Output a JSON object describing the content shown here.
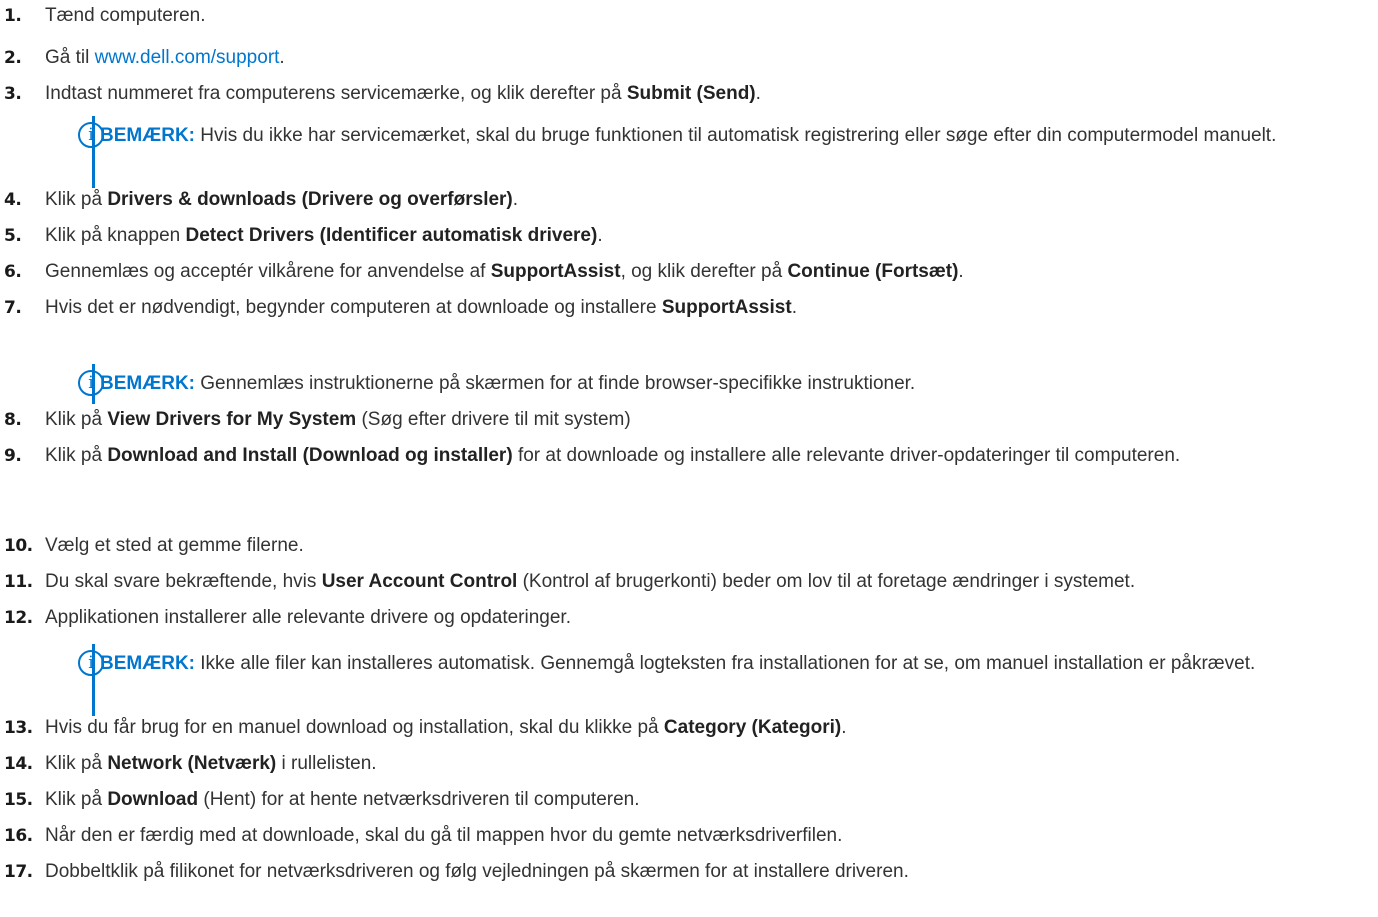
{
  "note_label": "BEMÆRK:",
  "steps": [
    {
      "n": "1.",
      "parts": [
        {
          "t": "Tænd computeren."
        }
      ]
    },
    {
      "n": "2.",
      "parts": [
        {
          "t": "Gå til "
        },
        {
          "t": "www.dell.com/support",
          "link": true
        },
        {
          "t": "."
        }
      ]
    },
    {
      "n": "3.",
      "parts": [
        {
          "t": "Indtast nummeret fra computerens servicemærke, og klik derefter på "
        },
        {
          "t": "Submit (Send)",
          "b": true
        },
        {
          "t": "."
        }
      ]
    },
    {
      "n": "4.",
      "parts": [
        {
          "t": "Klik på "
        },
        {
          "t": "Drivers & downloads (Drivere og overførsler)",
          "b": true
        },
        {
          "t": "."
        }
      ]
    },
    {
      "n": "5.",
      "parts": [
        {
          "t": "Klik på knappen "
        },
        {
          "t": "Detect Drivers (Identificer automatisk drivere)",
          "b": true
        },
        {
          "t": "."
        }
      ]
    },
    {
      "n": "6.",
      "parts": [
        {
          "t": "Gennemlæs og acceptér vilkårene for anvendelse af "
        },
        {
          "t": "SupportAssist",
          "b": true
        },
        {
          "t": ", og klik derefter på "
        },
        {
          "t": "Continue (Fortsæt)",
          "b": true
        },
        {
          "t": "."
        }
      ]
    },
    {
      "n": "7.",
      "parts": [
        {
          "t": "Hvis det er nødvendigt, begynder computeren at downloade og installere "
        },
        {
          "t": "SupportAssist",
          "b": true
        },
        {
          "t": "."
        }
      ]
    },
    {
      "n": "8.",
      "parts": [
        {
          "t": "Klik på "
        },
        {
          "t": "View Drivers for My System",
          "b": true
        },
        {
          "t": " (Søg efter drivere til mit system)"
        }
      ]
    },
    {
      "n": "9.",
      "parts": [
        {
          "t": "Klik på "
        },
        {
          "t": "Download and Install (Download og installer)",
          "b": true
        },
        {
          "t": " for at downloade og installere alle relevante driver-opdateringer til computeren."
        }
      ]
    },
    {
      "n": "10.",
      "parts": [
        {
          "t": "Vælg et sted at gemme filerne."
        }
      ]
    },
    {
      "n": "11.",
      "parts": [
        {
          "t": "Du skal svare bekræftende, hvis "
        },
        {
          "t": "User Account Control",
          "b": true
        },
        {
          "t": " (Kontrol af brugerkonti) beder om lov til at foretage ændringer i systemet."
        }
      ]
    },
    {
      "n": "12.",
      "parts": [
        {
          "t": "Applikationen installerer alle relevante drivere og opdateringer."
        }
      ]
    },
    {
      "n": "13.",
      "parts": [
        {
          "t": "Hvis du får brug for en manuel download og installation, skal du klikke på "
        },
        {
          "t": "Category (Kategori)",
          "b": true
        },
        {
          "t": "."
        }
      ]
    },
    {
      "n": "14.",
      "parts": [
        {
          "t": "Klik på "
        },
        {
          "t": "Network (Netværk)",
          "b": true
        },
        {
          "t": " i rullelisten."
        }
      ]
    },
    {
      "n": "15.",
      "parts": [
        {
          "t": "Klik på "
        },
        {
          "t": "Download",
          "b": true
        },
        {
          "t": " (Hent) for at hente netværksdriveren til computeren."
        }
      ]
    },
    {
      "n": "16.",
      "parts": [
        {
          "t": "Når den er færdig med at downloade, skal du gå til mappen hvor du gemte netværksdriverfilen."
        }
      ]
    },
    {
      "n": "17.",
      "parts": [
        {
          "t": "Dobbeltklik på filikonet for netværksdriveren og følg vejledningen på skærmen for at installere driveren."
        }
      ]
    }
  ],
  "notes": [
    {
      "text": "Hvis du ikke har servicemærket, skal du bruge funktionen til automatisk registrering eller søge efter din computermodel manuelt."
    },
    {
      "text": "Gennemlæs instruktionerne på skærmen for at finde browser-specifikke instruktioner."
    },
    {
      "text": "Ikke alle filer kan installeres automatisk. Gennemgå logteksten fra installationen for at se, om manuel installation er påkrævet."
    }
  ]
}
